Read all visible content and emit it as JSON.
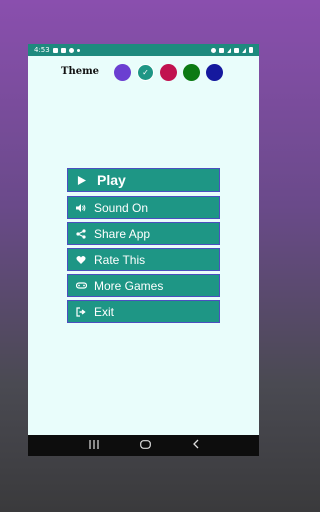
{
  "status_bar": {
    "time": "4:53"
  },
  "theme": {
    "label": "Theme",
    "colors": [
      {
        "name": "purple",
        "hex": "#6b3fd1",
        "selected": false
      },
      {
        "name": "teal",
        "hex": "#1e9685",
        "selected": true
      },
      {
        "name": "crimson",
        "hex": "#c1124f",
        "selected": false
      },
      {
        "name": "green",
        "hex": "#0c7a13",
        "selected": false
      },
      {
        "name": "blue",
        "hex": "#15199e",
        "selected": false
      }
    ],
    "check_glyph": "✓"
  },
  "menu": {
    "play": {
      "label": "Play",
      "icon": "play-icon"
    },
    "sound": {
      "label": "Sound On",
      "icon": "speaker-icon"
    },
    "share": {
      "label": "Share App",
      "icon": "share-icon"
    },
    "rate": {
      "label": "Rate This",
      "icon": "heart-icon"
    },
    "more": {
      "label": "More Games",
      "icon": "gamepad-icon"
    },
    "exit": {
      "label": "Exit",
      "icon": "exit-icon"
    }
  },
  "colors": {
    "accent": "#1e9685",
    "button_border": "#4b4fbf",
    "background": "#e9fdfb",
    "status_bar": "#1e8a7e"
  }
}
